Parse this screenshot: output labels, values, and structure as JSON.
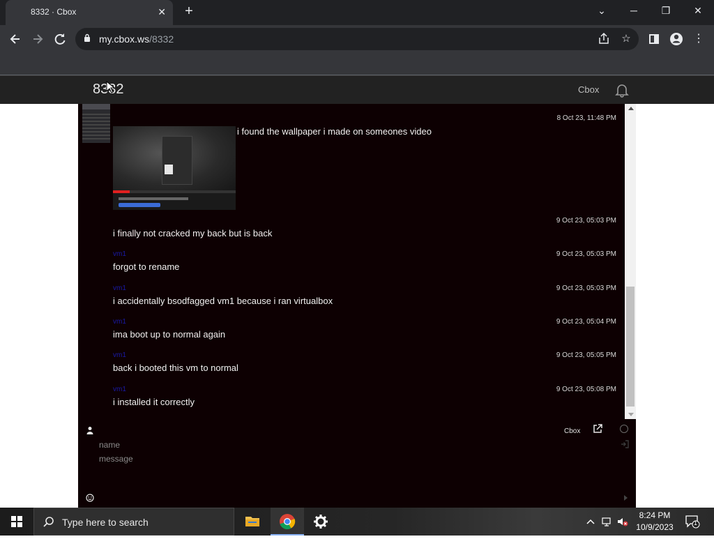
{
  "browser": {
    "tab_title": "8332 · Cbox",
    "new_tab": "+",
    "url_host": "my.cbox.ws",
    "url_path": "/8332",
    "window_controls": {
      "minimize": "─",
      "restore": "❐",
      "close": "✕",
      "tab_search": "⌄"
    }
  },
  "site": {
    "title": "8332",
    "brand": "Cbox"
  },
  "chat": {
    "first_message": {
      "time": "8 Oct 23, 11:48 PM",
      "caption": "i found the wallpaper i made on someones video"
    },
    "messages": [
      {
        "author": "",
        "time": "9 Oct 23, 05:03 PM",
        "text": "i finally not cracked my back but is back"
      },
      {
        "author": "vm1",
        "time": "9 Oct 23, 05:03 PM",
        "text": "forgot to rename"
      },
      {
        "author": "vm1",
        "time": "9 Oct 23, 05:03 PM",
        "text": "i accidentally bsodfagged vm1 because i ran virtualbox"
      },
      {
        "author": "vm1",
        "time": "9 Oct 23, 05:04 PM",
        "text": "ima boot up to normal again"
      },
      {
        "author": "vm1",
        "time": "9 Oct 23, 05:05 PM",
        "text": "back i booted this vm to normal"
      },
      {
        "author": "vm1",
        "time": "9 Oct 23, 05:08 PM",
        "text": "i installed it correctly"
      }
    ],
    "footer": {
      "brand": "Cbox",
      "name_placeholder": "name",
      "message_placeholder": "message"
    }
  },
  "taskbar": {
    "search_placeholder": "Type here to search",
    "time": "8:24 PM",
    "date": "10/9/2023",
    "notification_count": "1"
  },
  "colors": {
    "chat_bg": "#0d0002",
    "author": "#1a1aa8",
    "header_bg": "#222222"
  }
}
